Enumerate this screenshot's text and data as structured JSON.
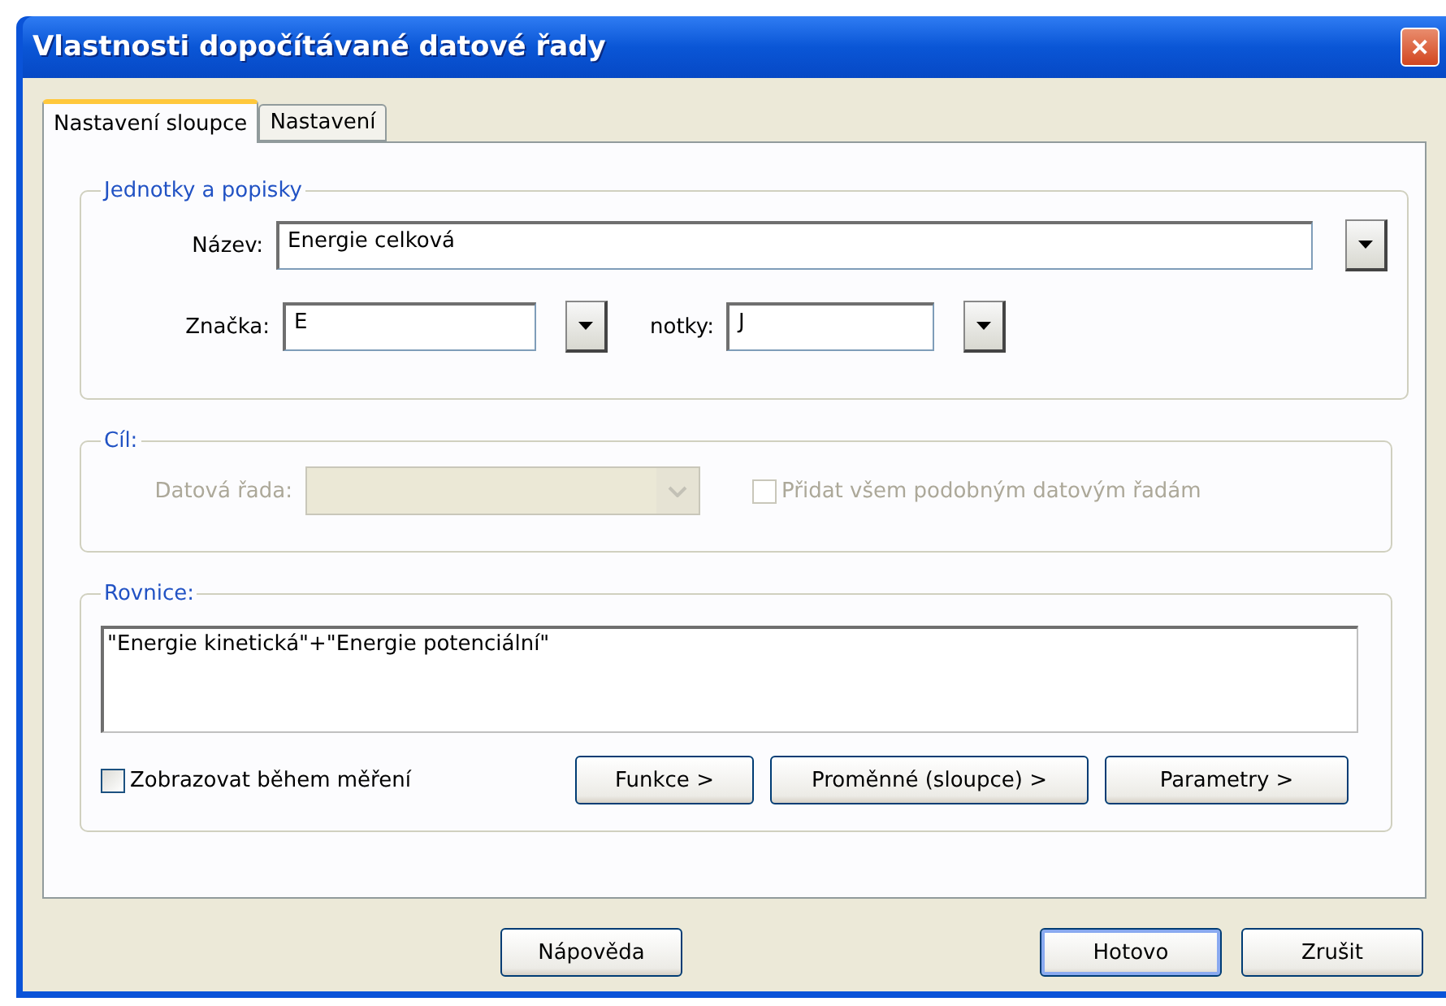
{
  "window": {
    "title": "Vlastnosti dopočítávané datové řady",
    "close_label": "✕"
  },
  "tabs": [
    {
      "label": "Nastavení sloupce",
      "selected": true
    },
    {
      "label": "Nastavení",
      "selected": false
    }
  ],
  "units_group": {
    "title": "Jednotky a popisky",
    "name_label": "Název:",
    "name_value": "Energie celková",
    "symbol_label": "Značka:",
    "symbol_value": "E",
    "units_label": "notky:",
    "units_value": "J"
  },
  "target_group": {
    "title": "Cíl:",
    "disabled": true,
    "series_label": "Datová řada:",
    "add_all": {
      "label": "Přidat všem podobným datovým řadám",
      "checked": false
    }
  },
  "equation_group": {
    "title": "Rovnice:",
    "value": "\"Energie kinetická\"+\"Energie potenciální\"",
    "show_during": {
      "label": "Zobrazovat během měření",
      "checked": false
    },
    "buttons": [
      "Funkce >",
      "Proměnné (sloupce) >",
      "Parametry >"
    ]
  },
  "footer": {
    "help": "Nápověda",
    "buttons": [
      {
        "label": "Hotovo",
        "default": true
      },
      {
        "label": "Zrušit",
        "default": false
      }
    ]
  }
}
